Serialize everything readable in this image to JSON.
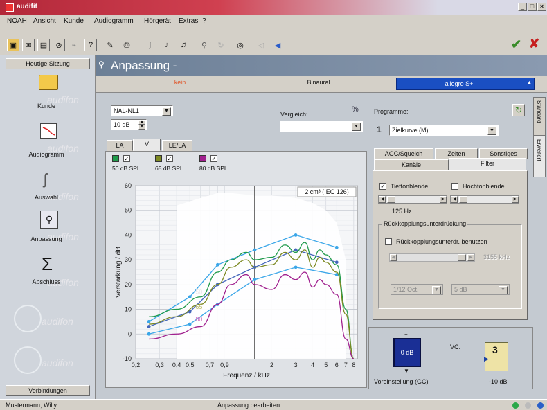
{
  "window": {
    "title": "audifit"
  },
  "menu": [
    "NOAH",
    "Ansicht",
    "Kunde",
    "Audiogramm",
    "Hörgerät",
    "Extras",
    "?"
  ],
  "toolbar": {
    "ok": "✔",
    "close": "✘"
  },
  "sidebar": {
    "header": "Heutige Sitzung",
    "footer": "Verbindungen",
    "watermark": "audifon",
    "items": [
      {
        "label": "Kunde",
        "icon": "folder-icon"
      },
      {
        "label": "Audiogramm",
        "icon": "audiogram-icon"
      },
      {
        "label": "Auswahl",
        "icon": "selection-icon"
      },
      {
        "label": "Anpassung",
        "icon": "fitting-icon"
      },
      {
        "label": "Abschluss",
        "icon": "sigma-icon"
      }
    ]
  },
  "page": {
    "title": "Anpassung -"
  },
  "ear_tabs": {
    "left": "kein",
    "middle": "Binaural",
    "right": "allegro S+"
  },
  "controls": {
    "formula": "NAL-NL1",
    "gain_step": "10 dB",
    "compare_label": "Vergleich:",
    "compare_value": "",
    "view_tabs": [
      "LA",
      "V",
      "LE/LA"
    ],
    "level_checks": [
      {
        "label": "50 dB SPL",
        "color": "#1f9a4a",
        "checked": true
      },
      {
        "label": "65 dB SPL",
        "color": "#7d8a23",
        "checked": true
      },
      {
        "label": "80 dB SPL",
        "color": "#a0208e",
        "checked": true
      }
    ]
  },
  "program": {
    "label": "Programme:",
    "number": "1",
    "value": "Zielkurve (M)"
  },
  "side_tabs": [
    "Standard",
    "Erweitert"
  ],
  "settings_tabs": {
    "row1": [
      "AGC/Squelch",
      "Zeiten",
      "Sonstiges"
    ],
    "row2": [
      "Kanäle",
      "Filter"
    ]
  },
  "filter": {
    "low_cut_label": "Tieftonblende",
    "low_cut_checked": true,
    "high_cut_label": "Hochtonblende",
    "high_cut_checked": false,
    "low_cut_freq": "125 Hz",
    "feedback_group": "Rückkopplungsunterdrückung",
    "feedback_use_label": "Rückkopplungsunterdr. benutzen",
    "feedback_use_checked": false,
    "feedback_freq": "3155 kHz",
    "oct_value": "1/12 Oct.",
    "db_value": "5 dB"
  },
  "bottom_controls": {
    "gc_value": "0 dB",
    "gc_label": "Voreinstellung (GC)",
    "vc_label": "VC:",
    "vc_value": "-10 dB",
    "vc_wheel": "3"
  },
  "status": {
    "user": "Mustermann, Willy",
    "action": "Anpassung bearbeiten"
  },
  "chart_data": {
    "type": "line",
    "annotation": "2 cm³ (IEC 126)",
    "xlabel": "Frequenz / kHz",
    "ylabel": "Verstärkung / dB",
    "xscale": "log",
    "xlim": [
      0.2,
      8.5
    ],
    "ylim": [
      -10,
      60
    ],
    "xticks": [
      0.2,
      0.3,
      0.4,
      0.5,
      0.7,
      0.9,
      2,
      3,
      4,
      5,
      6,
      7,
      8
    ],
    "xticklabels": [
      "0,2",
      "0,3",
      "0,4",
      "0,5",
      "0,7",
      "0,9",
      "2",
      "3",
      "4",
      "5",
      "6",
      "7",
      "8"
    ],
    "yticks": [
      -10,
      0,
      10,
      20,
      30,
      40,
      50,
      60
    ],
    "cursor_x": 1.5,
    "level_labels": [
      "50",
      "65",
      "80"
    ],
    "targets": [
      {
        "name": "target-50",
        "color": "#3aa6e8",
        "x": [
          0.25,
          0.5,
          0.8,
          1.5,
          3,
          6
        ],
        "y": [
          5,
          15,
          28,
          34,
          40,
          35
        ]
      },
      {
        "name": "target-65",
        "color": "#4466bb",
        "x": [
          0.25,
          0.5,
          0.8,
          1.5,
          3,
          6
        ],
        "y": [
          3,
          9,
          20,
          27,
          34,
          29
        ]
      },
      {
        "name": "target-80",
        "color": "#3aa6e8",
        "x": [
          0.25,
          0.5,
          0.8,
          1.5,
          3,
          6
        ],
        "y": [
          0,
          4,
          12,
          22,
          27,
          24
        ]
      }
    ],
    "series": [
      {
        "name": "50 dB SPL",
        "color": "#1f9a4a",
        "x": [
          0.25,
          0.4,
          0.6,
          0.8,
          1.0,
          1.3,
          1.5,
          2,
          2.5,
          3,
          3.5,
          4,
          4.5,
          5,
          6,
          7,
          8
        ],
        "y": [
          7,
          10,
          15,
          25,
          30,
          33,
          30,
          31,
          36,
          33,
          37,
          30,
          34,
          32,
          28,
          10,
          -10
        ]
      },
      {
        "name": "65 dB SPL",
        "color": "#7d8a23",
        "x": [
          0.25,
          0.4,
          0.6,
          0.8,
          1.0,
          1.3,
          1.5,
          2,
          2.5,
          3,
          3.5,
          4,
          4.5,
          5,
          6,
          7,
          8
        ],
        "y": [
          4,
          7,
          12,
          20,
          27,
          30,
          27,
          28,
          33,
          30,
          34,
          27,
          31,
          29,
          25,
          8,
          -10
        ]
      },
      {
        "name": "80 dB SPL",
        "color": "#a0208e",
        "x": [
          0.25,
          0.4,
          0.6,
          0.8,
          1.0,
          1.3,
          1.5,
          2,
          2.5,
          3,
          3.5,
          4,
          4.5,
          5,
          6,
          7,
          8
        ],
        "y": [
          -2,
          0,
          3,
          12,
          20,
          24,
          20,
          18,
          24,
          22,
          25,
          19,
          22,
          20,
          16,
          -2,
          -10
        ]
      }
    ]
  }
}
